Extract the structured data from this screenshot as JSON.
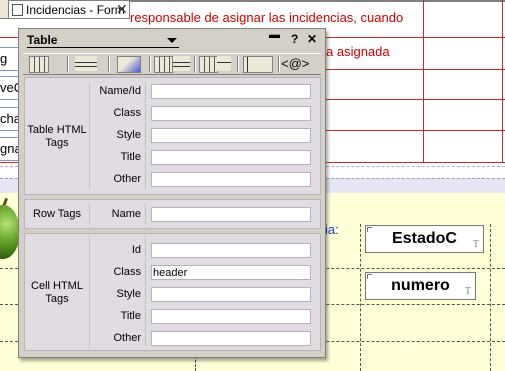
{
  "document": {
    "tab_title": "Incidencias - Form",
    "tab_close": "✕",
    "red_text_1": "responsable de asignar las incidencias, cuando",
    "red_text_2": "a asignada",
    "fields": [
      "g",
      "veC",
      "cha",
      "gna"
    ],
    "blue_text": "ia:",
    "estado_label": "EstadoC",
    "numero_label": "numero",
    "t_marker": "T",
    "colors": {
      "red": "#cc2a2a",
      "lilac": "#e6e6f5",
      "yellow": "#ffffd8"
    }
  },
  "panel": {
    "title": "Table",
    "menu_button": "▬",
    "help_button": "?",
    "close_button": "✕",
    "toolbar_icons": [
      "table-icon",
      "row-icon",
      "cell-icon",
      "column-icon",
      "table-row-icon",
      "span-icon",
      "code-tags-icon"
    ],
    "code_tags_label": "<@>",
    "table_section": {
      "label": "Table HTML Tags",
      "rows": [
        {
          "label": "Name/Id",
          "value": ""
        },
        {
          "label": "Class",
          "value": ""
        },
        {
          "label": "Style",
          "value": ""
        },
        {
          "label": "Title",
          "value": ""
        },
        {
          "label": "Other",
          "value": ""
        }
      ]
    },
    "row_section": {
      "label": "Row Tags",
      "rows": [
        {
          "label": "Name",
          "value": ""
        }
      ]
    },
    "cell_section": {
      "label": "Cell HTML Tags",
      "rows": [
        {
          "label": "Id",
          "value": ""
        },
        {
          "label": "Class",
          "value": "header"
        },
        {
          "label": "Style",
          "value": ""
        },
        {
          "label": "Title",
          "value": ""
        },
        {
          "label": "Other",
          "value": ""
        }
      ]
    }
  }
}
